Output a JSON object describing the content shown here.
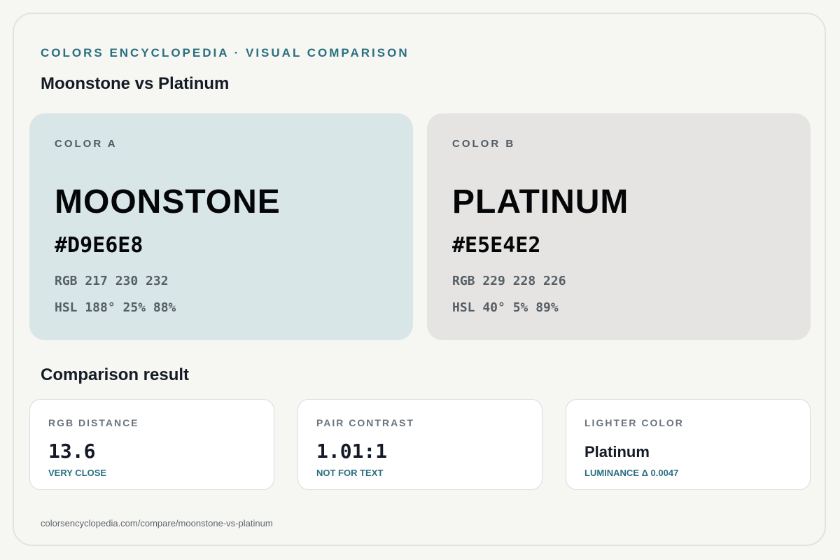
{
  "header": {
    "eyebrow": "COLORS ENCYCLOPEDIA · VISUAL COMPARISON",
    "title": "Moonstone vs Platinum"
  },
  "colors": [
    {
      "label": "COLOR A",
      "name": "MOONSTONE",
      "hex": "#D9E6E8",
      "rgb": "RGB 217 230 232",
      "hsl": "HSL 188° 25% 88%",
      "swatch_color": "#D9E6E8"
    },
    {
      "label": "COLOR B",
      "name": "PLATINUM",
      "hex": "#E5E4E2",
      "rgb": "RGB 229 228 226",
      "hsl": "HSL 40° 5% 89%",
      "swatch_color": "#E5E4E2"
    }
  ],
  "comparison": {
    "title": "Comparison result",
    "stats": [
      {
        "label": "RGB DISTANCE",
        "value": "13.6",
        "note": "VERY CLOSE"
      },
      {
        "label": "PAIR CONTRAST",
        "value": "1.01:1",
        "note": "NOT FOR TEXT"
      },
      {
        "label": "LIGHTER COLOR",
        "value": "Platinum",
        "note": "LUMINANCE Δ 0.0047"
      }
    ]
  },
  "footer": {
    "url": "colorsencyclopedia.com/compare/moonstone-vs-platinum"
  },
  "theme": {
    "accent": "#2A6F80",
    "background": "#F6F6F2",
    "text": "#141B26"
  }
}
